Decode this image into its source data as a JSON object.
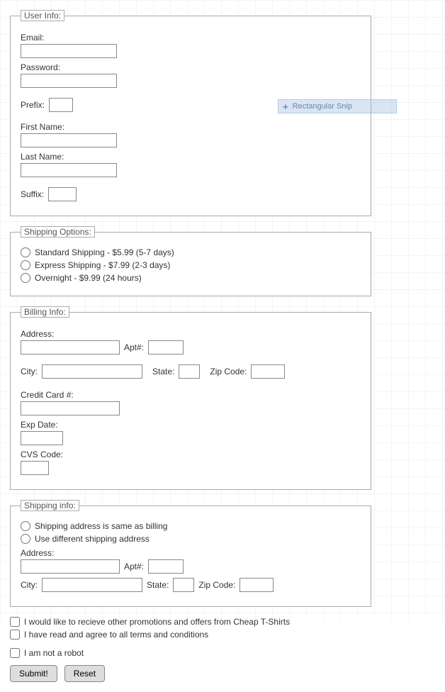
{
  "overlay": {
    "label": "Rectangular Snip"
  },
  "user": {
    "legend": "User Info:",
    "email_label": "Email:",
    "password_label": "Password:",
    "prefix_label": "Prefix:",
    "firstname_label": "First Name:",
    "lastname_label": "Last Name:",
    "suffix_label": "Suffix:"
  },
  "shipping_options": {
    "legend": "Shipping Options:",
    "opt1": "Standard Shipping - $5.99 (5-7 days)",
    "opt2": "Express Shipping - $7.99 (2-3 days)",
    "opt3": "Overnight - $9.99 (24 hours)"
  },
  "billing": {
    "legend": "Billing Info:",
    "address_label": "Address:",
    "apt_label": "Apt#:",
    "city_label": "City:",
    "state_label": "State:",
    "zip_label": "Zip Code:",
    "cc_label": "Credit Card #:",
    "exp_label": "Exp Date:",
    "cvs_label": "CVS Code:"
  },
  "shipping_info": {
    "legend": "Shipping info:",
    "same_label": "Shipping address is same as billing",
    "diff_label": "Use different shipping address",
    "address_label": "Address:",
    "apt_label": "Apt#:",
    "city_label": "City:",
    "state_label": "State:",
    "zip_label": "Zip Code:"
  },
  "checks": {
    "promo": "I would like to recieve other promotions and offers from Cheap T-Shirts",
    "terms": "I have read and agree to all terms and conditions",
    "robot": "I am not a robot"
  },
  "buttons": {
    "submit": "Submit!",
    "reset": "Reset"
  }
}
